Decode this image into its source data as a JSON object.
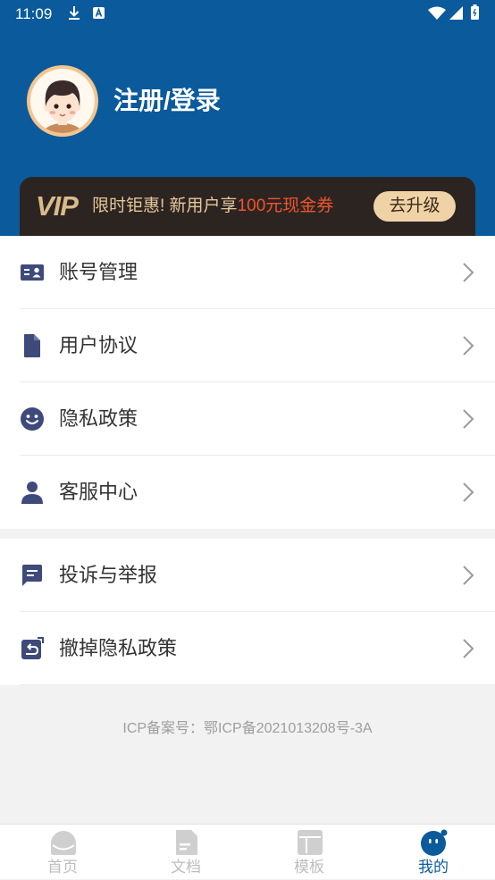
{
  "status_bar": {
    "time": "11:09"
  },
  "header": {
    "login_text": "注册/登录"
  },
  "vip_banner": {
    "badge": "VIP",
    "promo_prefix": "限时钜惠! 新用户享",
    "promo_highlight": "100元现金券",
    "upgrade_label": "去升级"
  },
  "menu_groups": [
    {
      "items": [
        {
          "label": "账号管理",
          "icon": "id-card-icon"
        },
        {
          "label": "用户协议",
          "icon": "document-icon"
        },
        {
          "label": "隐私政策",
          "icon": "smiley-icon"
        },
        {
          "label": "客服中心",
          "icon": "person-icon"
        }
      ]
    },
    {
      "items": [
        {
          "label": "投诉与举报",
          "icon": "message-icon"
        },
        {
          "label": "撤掉隐私政策",
          "icon": "revoke-icon"
        }
      ]
    }
  ],
  "footer": {
    "icp": "ICP备案号：鄂ICP备2021013208号-3A"
  },
  "bottom_nav": {
    "items": [
      {
        "label": "首页",
        "icon": "home-icon",
        "active": false
      },
      {
        "label": "文档",
        "icon": "document-icon",
        "active": false
      },
      {
        "label": "模板",
        "icon": "template-icon",
        "active": false
      },
      {
        "label": "我的",
        "icon": "profile-icon",
        "active": true
      }
    ]
  },
  "colors": {
    "primary": "#0B5A9C",
    "vip_background": "#2C2421",
    "vip_gold": "#E6C79A",
    "vip_highlight": "#F0542D",
    "menu_icon": "#3E4A7A",
    "nav_inactive": "#BDBDBD"
  }
}
